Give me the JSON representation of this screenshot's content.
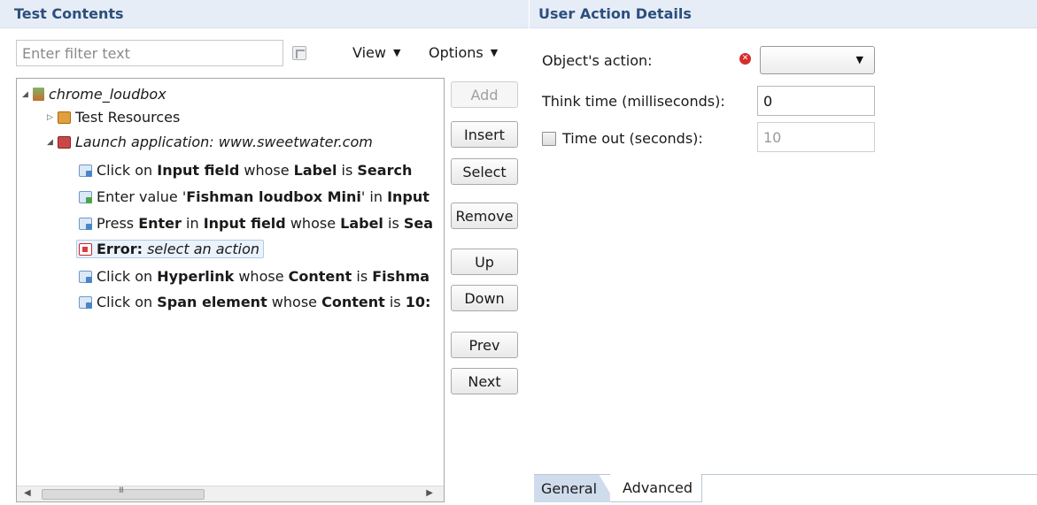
{
  "left_panel": {
    "title": "Test Contents",
    "filter_placeholder": "Enter filter text",
    "view_menu": "View",
    "options_menu": "Options",
    "tree": {
      "root": "chrome_loudbox",
      "resources": "Test Resources",
      "launch": "Launch application: www.sweetwater.com",
      "items": [
        {
          "parts": [
            "Click on ",
            "Input field",
            " whose ",
            "Label",
            " is ",
            "Search"
          ]
        },
        {
          "parts": [
            "Enter value '",
            "Fishman loudbox Mini",
            "' in ",
            "Input"
          ]
        },
        {
          "parts": [
            "Press ",
            "Enter",
            " in ",
            "Input field",
            " whose ",
            "Label",
            " is ",
            "Sea"
          ]
        },
        {
          "error_label": "Error:",
          "error_text": " select an action"
        },
        {
          "parts": [
            "Click on ",
            "Hyperlink",
            " whose ",
            "Content",
            " is ",
            "Fishma"
          ]
        },
        {
          "parts": [
            "Click on ",
            "Span element",
            " whose ",
            "Content",
            " is ",
            "10:"
          ]
        }
      ]
    },
    "scrollbar_grip": "III",
    "buttons": {
      "add": "Add",
      "insert": "Insert",
      "select": "Select",
      "remove": "Remove",
      "up": "Up",
      "down": "Down",
      "prev": "Prev",
      "next": "Next"
    }
  },
  "right_panel": {
    "title": "User Action Details",
    "object_action_label": "Object's action:",
    "object_action_value": "",
    "think_time_label": "Think time (milliseconds):",
    "think_time_value": "0",
    "timeout_label": "Time out (seconds):",
    "timeout_value": "10",
    "timeout_checked": false,
    "tabs": [
      "General",
      "Advanced"
    ],
    "active_tab": "General"
  },
  "icons": {
    "error_badge": "error-icon",
    "filter_clear": "clear-filter-icon",
    "dropdown": "chevron-down-icon"
  }
}
